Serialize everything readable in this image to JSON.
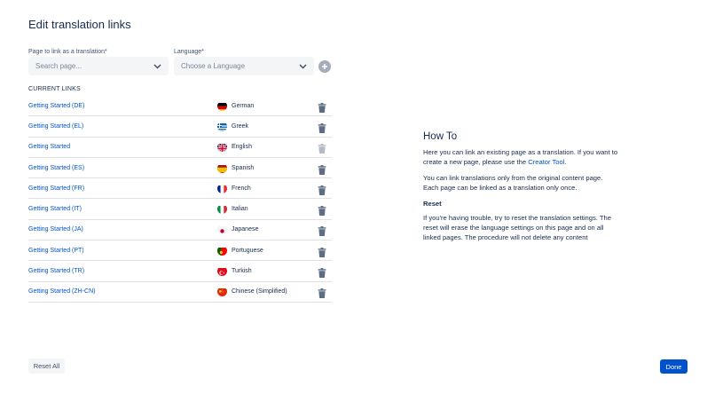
{
  "dialog": {
    "title": "Edit translation links"
  },
  "form": {
    "page_label": "Page to link as a translation*",
    "page_placeholder": "Search page...",
    "language_label": "Language*",
    "language_placeholder": "Choose a Language"
  },
  "links": {
    "heading": "CURRENT LINKS",
    "rows": [
      {
        "page": "Getting Started (DE)",
        "language": "German",
        "flag_icon": "germany-flag-icon",
        "delete_enabled": true
      },
      {
        "page": "Getting Started (EL)",
        "language": "Greek",
        "flag_icon": "greece-flag-icon",
        "delete_enabled": true
      },
      {
        "page": "Getting Started",
        "language": "English",
        "flag_icon": "uk-flag-icon",
        "delete_enabled": false
      },
      {
        "page": "Getting Started (ES)",
        "language": "Spanish",
        "flag_icon": "spain-flag-icon",
        "delete_enabled": true
      },
      {
        "page": "Getting Started (FR)",
        "language": "French",
        "flag_icon": "france-flag-icon",
        "delete_enabled": true
      },
      {
        "page": "Getting Started (IT)",
        "language": "Italian",
        "flag_icon": "italy-flag-icon",
        "delete_enabled": true
      },
      {
        "page": "Getting Started (JA)",
        "language": "Japanese",
        "flag_icon": "japan-flag-icon",
        "delete_enabled": true
      },
      {
        "page": "Getting Started (PT)",
        "language": "Portuguese",
        "flag_icon": "portugal-flag-icon",
        "delete_enabled": true
      },
      {
        "page": "Getting Started (TR)",
        "language": "Turkish",
        "flag_icon": "turkey-flag-icon",
        "delete_enabled": true
      },
      {
        "page": "Getting Started (ZH-CN)",
        "language": "Chinese (Simplified)",
        "flag_icon": "china-flag-icon",
        "delete_enabled": true
      }
    ]
  },
  "howto": {
    "title": "How To",
    "p1_text": "Here you can link an existing page as a translation. If you want to create a new page, please use the ",
    "p1_link": "Creator Tool",
    "p1_end": ".",
    "p2": "You can link translations only from the original content page. Each page can be linked as a translation only once.",
    "reset_heading": "Reset",
    "p3": "If you're having trouble, try to reset the translation settings. The reset will erase the language settings on this page and on all linked pages. The procedure will not delete any content"
  },
  "footer": {
    "reset_label": "Reset All",
    "done_label": "Done"
  },
  "colors": {
    "link": "#0052cc",
    "primary_button": "#0052cc",
    "text": "#172b4d",
    "field_bg": "#f4f5f7"
  }
}
